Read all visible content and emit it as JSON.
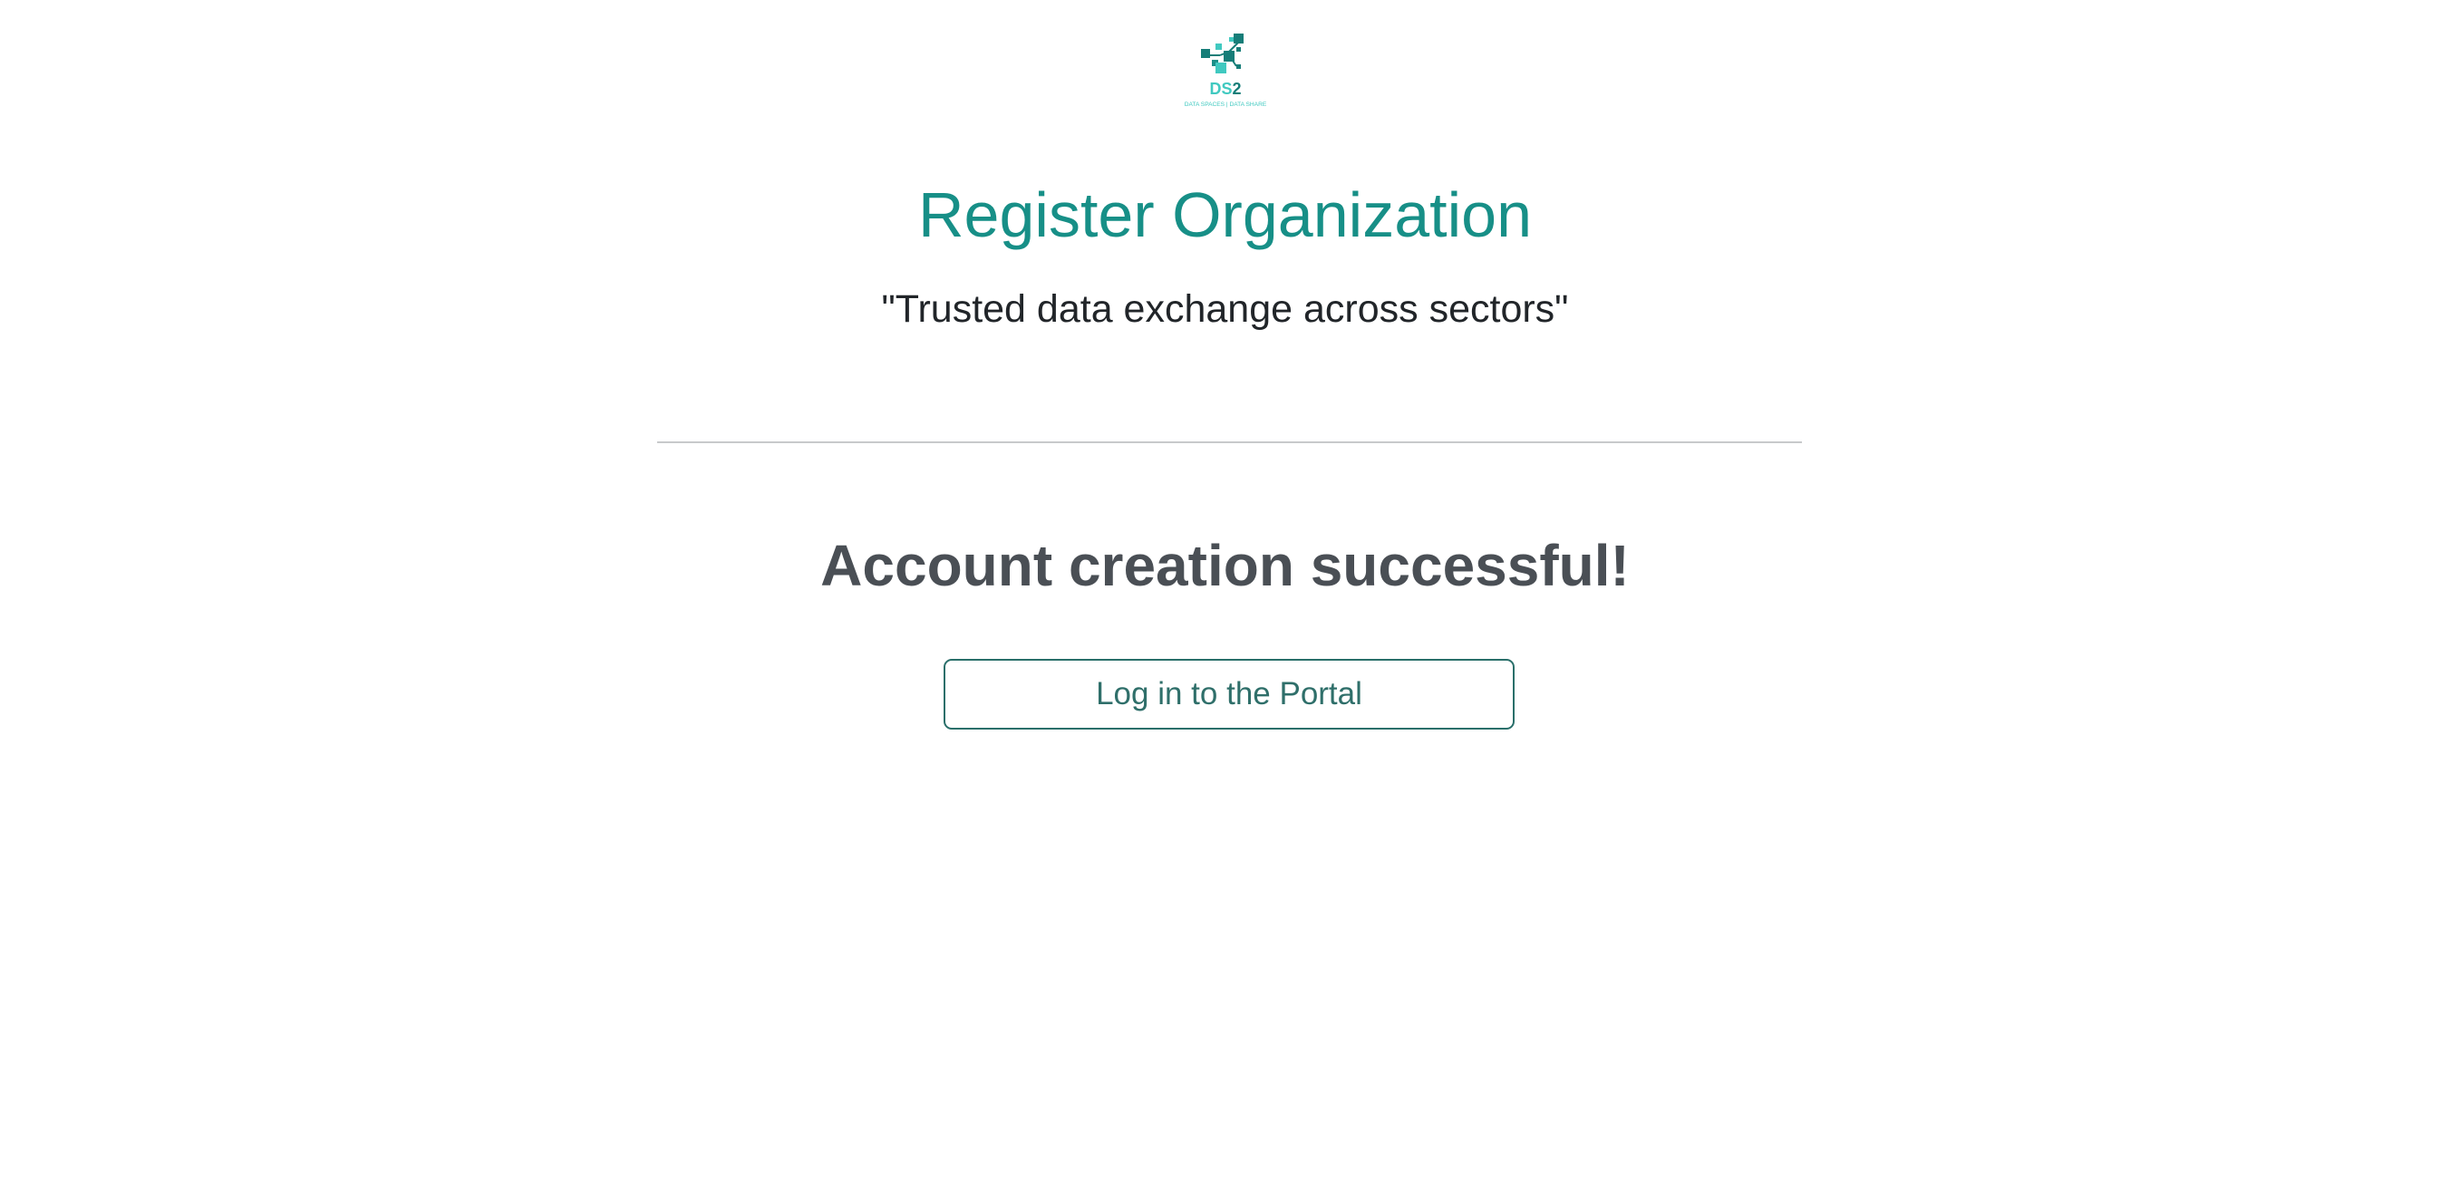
{
  "logo": {
    "text": "DS2",
    "subtitle": "DATA SPACES | DATA SHARE",
    "icon": "ds2-logo-icon",
    "colors": {
      "dark": "#167d78",
      "light": "#40c9c0"
    }
  },
  "page": {
    "title": "Register Organization",
    "tagline": "\"Trusted data exchange across sectors\"",
    "success_message": "Account creation successful!",
    "login_button": "Log in to the Portal"
  },
  "colors": {
    "title": "#178f87",
    "text": "#212529",
    "success": "#4a4f55",
    "button_border": "#2a6f6a",
    "divider": "#c8c9cb"
  }
}
